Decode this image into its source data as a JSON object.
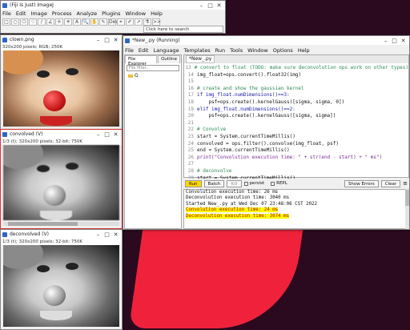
{
  "fiji": {
    "title": "(Fiji Is Just) ImageJ",
    "menu": [
      "File",
      "Edit",
      "Image",
      "Process",
      "Analyze",
      "Plugins",
      "Window",
      "Help"
    ],
    "tools": [
      "□",
      "○",
      "⬠",
      "♡",
      "∕",
      "∠",
      "✛",
      "✳",
      "A",
      "🔍",
      "✋",
      "✎",
      "Dev",
      "⌖",
      "✐",
      "↗",
      "⚗",
      ">>"
    ],
    "status": "Click here to search"
  },
  "win_clown": {
    "title": "clown.png",
    "info": "320x200 pixels; RGB; 250K"
  },
  "win_convolved": {
    "title": "convolved (V)",
    "info": "1/3 (t); 320x200 pixels; 32-bit; 750K"
  },
  "win_deconvolved": {
    "title": "deconvolved (V)",
    "info": "1/3 (t); 320x200 pixels; 32-bit; 750K"
  },
  "editor": {
    "title": "*New_.py (Running)",
    "menu": [
      "File",
      "Edit",
      "Language",
      "Templates",
      "Run",
      "Tools",
      "Window",
      "Options",
      "Help"
    ],
    "file_explorer_tab": "File Explorer",
    "outline_tab": "Outline",
    "filter_placeholder": "File filter...",
    "tree_root": "G",
    "code_tab": "*New_.py",
    "code": [
      {
        "n": "13",
        "t": "# convert to float (TODO: make sure deconvolution ops work on other types)",
        "c": "cm"
      },
      {
        "n": "14",
        "t": "img_float=ops.convert().float32(img)",
        "c": ""
      },
      {
        "n": "15",
        "t": "",
        "c": ""
      },
      {
        "n": "16",
        "t": "# create and show the gaussian kernel",
        "c": "cm"
      },
      {
        "n": "17",
        "t": "if img_float.numDimensions()==3:",
        "c": "kw"
      },
      {
        "n": "18",
        "t": "    psf=ops.create().kernelGauss([sigma, sigma, 0])",
        "c": ""
      },
      {
        "n": "19",
        "t": "elif img_float.numDimensions()==2:",
        "c": "kw"
      },
      {
        "n": "20",
        "t": "    psf=ops.create().kernelGauss([sigma, sigma])",
        "c": ""
      },
      {
        "n": "21",
        "t": "",
        "c": ""
      },
      {
        "n": "22",
        "t": "# Convolve",
        "c": "cm"
      },
      {
        "n": "23",
        "t": "start = System.currentTimeMillis()",
        "c": ""
      },
      {
        "n": "24",
        "t": "convolved = ops.filter().convolve(img_float, psf)",
        "c": ""
      },
      {
        "n": "25",
        "t": "end = System.currentTimeMillis()",
        "c": ""
      },
      {
        "n": "26",
        "t": "print(\"Convolution execution time: \" + str(end - start) + \" ms\")",
        "c": "fn"
      },
      {
        "n": "27",
        "t": "",
        "c": ""
      },
      {
        "n": "28",
        "t": "# deconvolve",
        "c": "cm"
      },
      {
        "n": "29",
        "t": "start = System.currentTimeMillis()",
        "c": ""
      }
    ],
    "console": {
      "run": "Run",
      "batch": "Batch",
      "kill": "Kill",
      "persist": "persist",
      "clear": "Clear",
      "show_errors": "Show Errors",
      "repl": "REPL",
      "lines": [
        {
          "t": "Convolution execution time: 26 ms",
          "hl": false
        },
        {
          "t": "Deconvolution execution time: 3040 ms",
          "hl": false
        },
        {
          "t": "Started New_.py at Wed Dec 07 23:48:06 CST 2022",
          "hl": false
        },
        {
          "t": "Convolution execution time: 24 ms",
          "hl": true
        },
        {
          "t": "Deconvolution execution time: 3074 ms",
          "hl": true
        }
      ]
    }
  }
}
